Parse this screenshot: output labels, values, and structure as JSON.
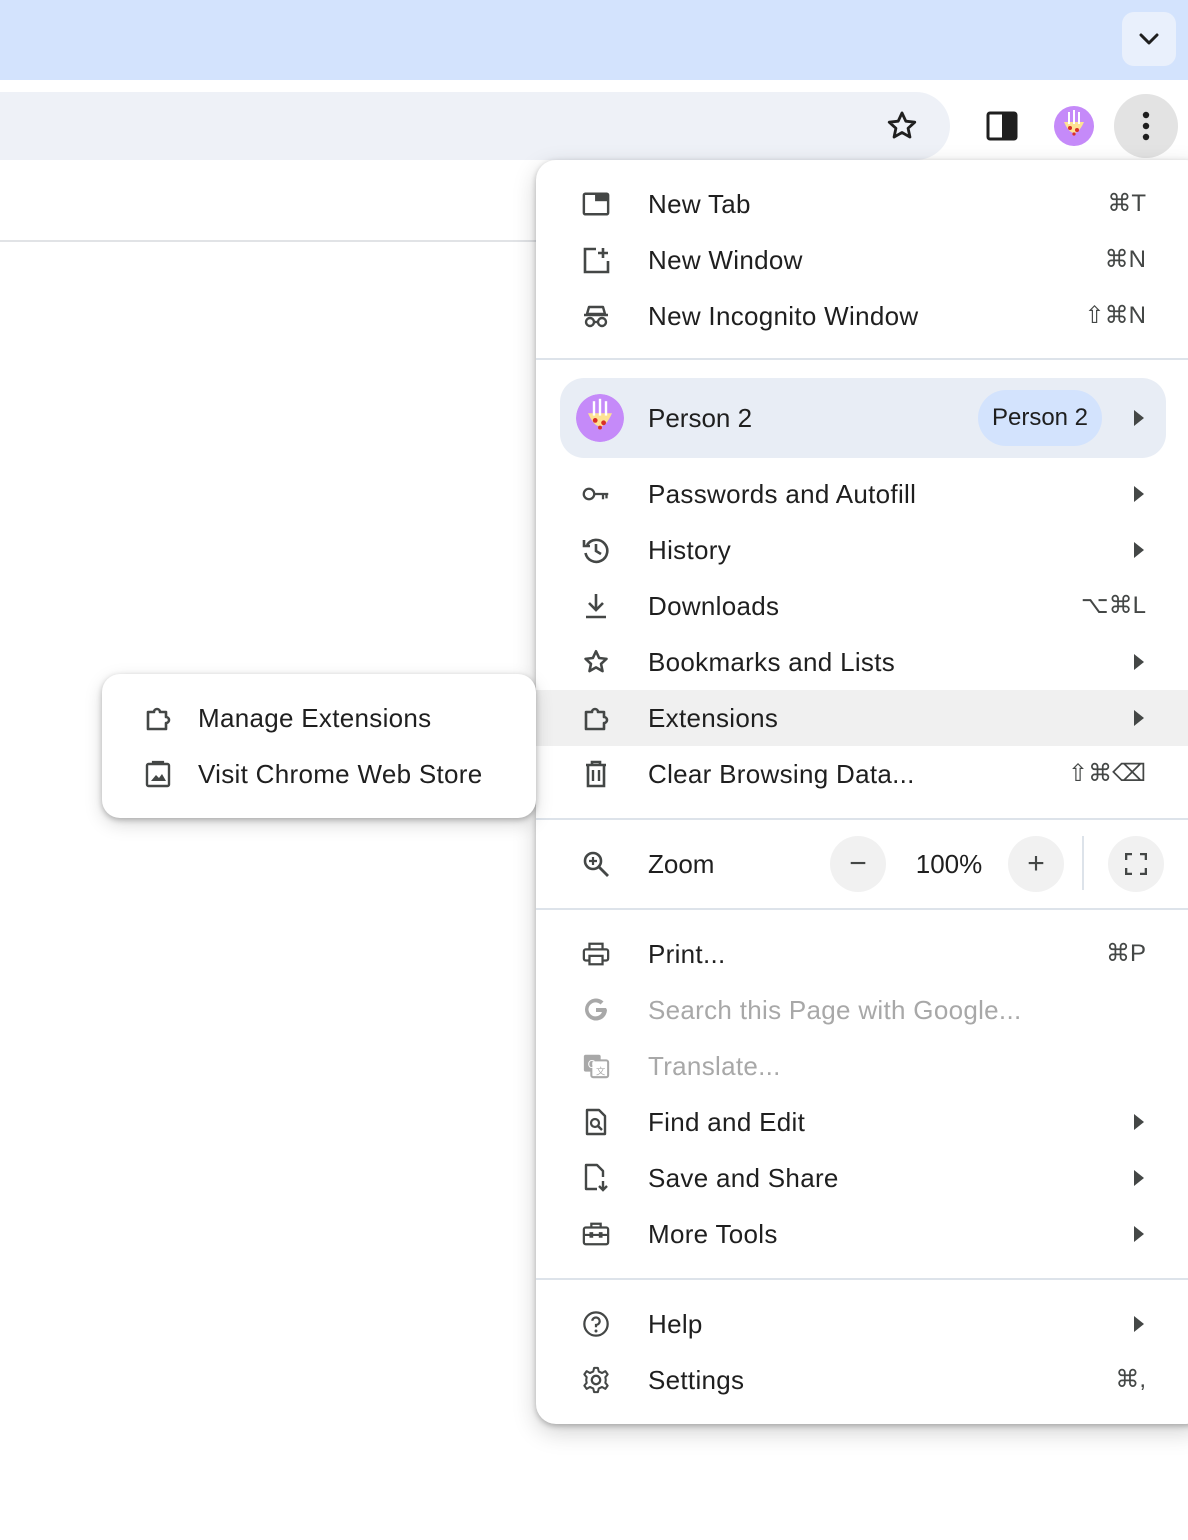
{
  "toolbar": {
    "tab_search_icon": "chevron-down-icon",
    "bookmark_icon": "star-icon",
    "side_panel_icon": "side-panel-icon",
    "profile_icon": "avatar",
    "menu_icon": "more-vert-icon"
  },
  "menu": {
    "items_top": [
      {
        "label": "New Tab",
        "shortcut": "⌘T",
        "icon": "new-tab-icon"
      },
      {
        "label": "New Window",
        "shortcut": "⌘N",
        "icon": "new-window-icon"
      },
      {
        "label": "New Incognito Window",
        "shortcut": "⇧⌘N",
        "icon": "incognito-icon"
      }
    ],
    "profile": {
      "label": "Person 2",
      "badge": "Person 2"
    },
    "items_mid": [
      {
        "label": "Passwords and Autofill",
        "icon": "key-icon"
      },
      {
        "label": "History",
        "icon": "history-icon"
      },
      {
        "label": "Downloads",
        "shortcut": "⌥⌘L",
        "icon": "download-icon"
      },
      {
        "label": "Bookmarks and Lists",
        "icon": "star-icon"
      },
      {
        "label": "Extensions",
        "icon": "extension-icon"
      },
      {
        "label": "Clear Browsing Data...",
        "shortcut": "⇧⌘⌫",
        "icon": "trash-icon"
      }
    ],
    "zoom": {
      "label": "Zoom",
      "value": "100%",
      "minus": "−",
      "plus": "+"
    },
    "items_tools": [
      {
        "label": "Print...",
        "shortcut": "⌘P",
        "icon": "print-icon"
      },
      {
        "label": "Search this Page with Google...",
        "icon": "google-icon",
        "disabled": true
      },
      {
        "label": "Translate...",
        "icon": "translate-icon",
        "disabled": true
      },
      {
        "label": "Find and Edit",
        "icon": "find-icon"
      },
      {
        "label": "Save and Share",
        "icon": "save-share-icon"
      },
      {
        "label": "More Tools",
        "icon": "toolbox-icon"
      }
    ],
    "items_bottom": [
      {
        "label": "Help",
        "icon": "help-icon"
      },
      {
        "label": "Settings",
        "shortcut": "⌘,",
        "icon": "gear-icon"
      }
    ]
  },
  "submenu": {
    "items": [
      {
        "label": "Manage Extensions",
        "icon": "extension-icon"
      },
      {
        "label": "Visit Chrome Web Store",
        "icon": "web-store-icon"
      }
    ]
  },
  "colors": {
    "tabstrip": "#d3e3fd",
    "highlight": "#f0f0f0",
    "profile_bg": "#e8edf5",
    "badge_bg": "#d3e3fd",
    "avatar_bg": "#c58af9"
  }
}
